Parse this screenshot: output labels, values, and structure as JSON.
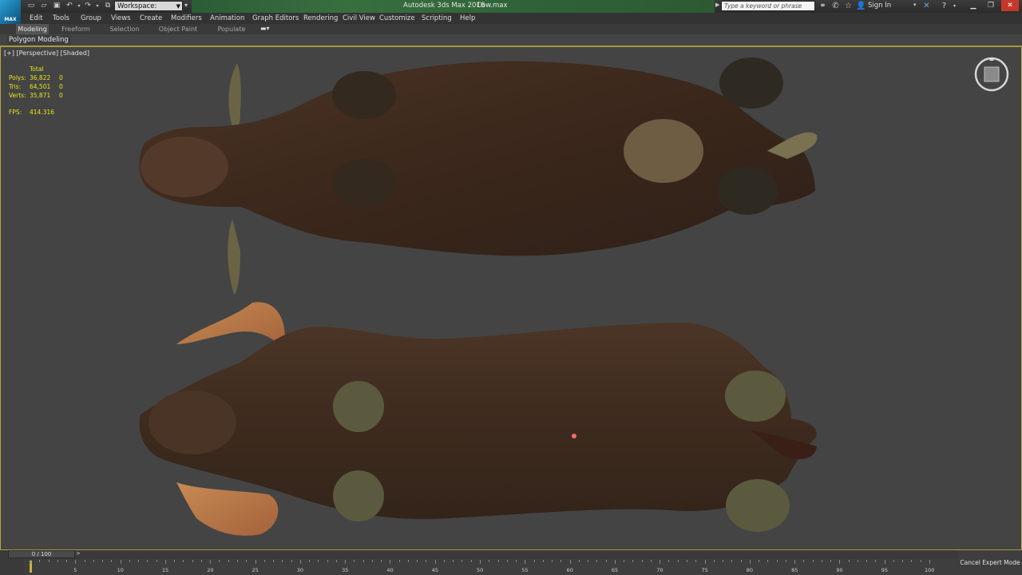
{
  "app": {
    "name": "Autodesk 3ds Max 2016",
    "file": "Cow.max",
    "logo_text": "MAX"
  },
  "quick_access": {
    "workspace_label": "Workspace: Default"
  },
  "search": {
    "placeholder": "Type a keyword or phrase"
  },
  "account": {
    "sign_in": "Sign In"
  },
  "menu": [
    "Edit",
    "Tools",
    "Group",
    "Views",
    "Create",
    "Modifiers",
    "Animation",
    "Graph Editors",
    "Rendering",
    "Civil View",
    "Customize",
    "Scripting",
    "Help"
  ],
  "ribbon": {
    "tabs": [
      "Modeling",
      "Freeform",
      "Selection",
      "Object Paint",
      "Populate"
    ],
    "active_tab": "Modeling",
    "panel_title": "Polygon Modeling"
  },
  "viewport": {
    "label": "[+] [Perspective] [Shaded]",
    "stats": {
      "header": "Total",
      "rows": [
        {
          "label": "Polys:",
          "total": "36,822",
          "selected": "0"
        },
        {
          "label": "Tris:",
          "total": "64,501",
          "selected": "0"
        },
        {
          "label": "Verts:",
          "total": "35,871",
          "selected": "0"
        }
      ],
      "fps_label": "FPS:",
      "fps_value": "414.316"
    }
  },
  "timeline": {
    "slider_text": "0 / 100",
    "current_frame": 0,
    "tick_labels": [
      "5",
      "10",
      "15",
      "20",
      "25",
      "30",
      "35",
      "40",
      "45",
      "50",
      "55",
      "60",
      "65",
      "70",
      "75",
      "80",
      "85",
      "90",
      "95",
      "100"
    ]
  },
  "status": {
    "cancel_expert": "Cancel Expert Mode"
  },
  "colors": {
    "accent_gold": "#a59a3c",
    "title_green": "#386f3f",
    "stats_yellow": "#e6e61a",
    "viewport_bg": "#444444"
  }
}
